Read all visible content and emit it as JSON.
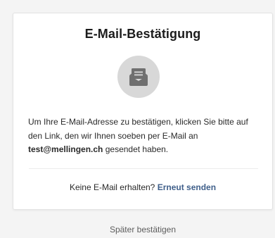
{
  "card": {
    "title": "E-Mail-Bestätigung",
    "icon": "open-envelope-letter-icon",
    "message_prefix": "Um Ihre E-Mail-Adresse zu bestätigen, klicken Sie bitte auf den Link, den wir Ihnen soeben per E-Mail an ",
    "email": "test@mellingen.ch",
    "message_suffix": " gesendet haben.",
    "resend_question": "Keine E-Mail erhalten?",
    "resend_link": "Erneut senden"
  },
  "footer": {
    "later_label": "Später bestätigen"
  },
  "colors": {
    "background": "#f4f4f4",
    "card": "#ffffff",
    "icon_circle": "#d8d8d8",
    "icon": "#6f6f6f",
    "link": "#3f5f8a"
  }
}
